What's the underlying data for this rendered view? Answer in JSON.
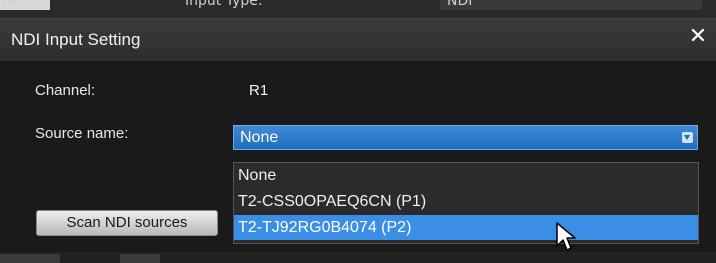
{
  "background": {
    "strip_text_left": "re",
    "strip_text_mid": "Input Type:",
    "strip_text_right": "NDI"
  },
  "dialog": {
    "title": "NDI Input Setting",
    "close_glyph": "✕"
  },
  "channel": {
    "label": "Channel:",
    "value": "R1"
  },
  "source": {
    "label": "Source name:",
    "selected": "None",
    "options": [
      "None",
      "T2-CSS0OPAEQ6CN (P1)",
      "T2-TJ92RG0B4074 (P2)"
    ],
    "highlighted_index": 2
  },
  "scan_button": {
    "label": "Scan NDI sources"
  },
  "colors": {
    "accent": "#1e6ebd",
    "highlight": "#3b8ee6"
  },
  "icons": [
    "close-icon",
    "chevron-down-icon",
    "mouse-pointer-icon"
  ]
}
